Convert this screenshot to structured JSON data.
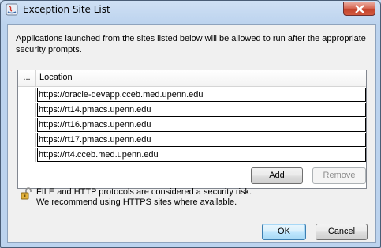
{
  "window": {
    "title": "Exception Site List",
    "close_icon": "close-icon",
    "app_icon": "java-app-icon"
  },
  "intro_text": "Applications launched from the sites listed below will be allowed to run after the appropriate security prompts.",
  "table": {
    "columns": [
      "...",
      "Location"
    ],
    "rows": [
      "https://oracle-devapp.cceb.med.upenn.edu",
      "https://rt14.pmacs.upenn.edu",
      "https://rt16.pmacs.upenn.edu",
      "https://rt17.pmacs.upenn.edu",
      "https://rt4.cceb.med.upenn.edu"
    ]
  },
  "buttons": {
    "add": "Add",
    "remove": "Remove",
    "ok": "OK",
    "cancel": "Cancel"
  },
  "warning": {
    "icon": "unlocked-padlock-icon",
    "line1": "FILE and HTTP protocols are considered a security risk.",
    "line2": "We recommend using HTTPS sites where available."
  }
}
